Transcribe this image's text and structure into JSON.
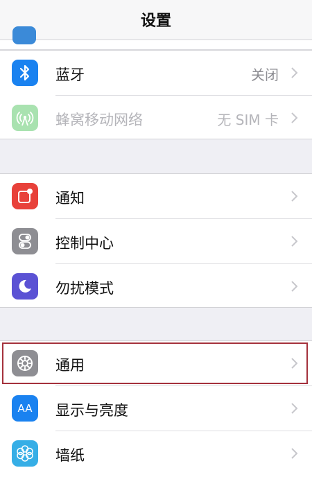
{
  "nav": {
    "title": "设置"
  },
  "groups": {
    "connectivity": {
      "bluetooth": {
        "label": "蓝牙",
        "value": "关闭",
        "icon": "bluetooth-icon",
        "color": "#1a82f0"
      },
      "cellular": {
        "label": "蜂窝移动网络",
        "value": "无 SIM 卡",
        "icon": "antenna-icon",
        "color": "#a9e2b0",
        "disabled": true
      }
    },
    "alerts": {
      "notifications": {
        "label": "通知",
        "icon": "notification-icon",
        "color": "#e8413a"
      },
      "control_center": {
        "label": "控制中心",
        "icon": "toggle-icon",
        "color": "#8e8e93"
      },
      "do_not_disturb": {
        "label": "勿扰模式",
        "icon": "moon-icon",
        "color": "#5b52d4"
      }
    },
    "system": {
      "general": {
        "label": "通用",
        "icon": "gear-icon",
        "color": "#8e8e93",
        "highlighted": true
      },
      "display": {
        "label": "显示与亮度",
        "icon": "text-size-icon",
        "color": "#1a82f0",
        "icon_text": "AA"
      },
      "wallpaper": {
        "label": "墙纸",
        "icon": "flower-icon",
        "color": "#36aee6"
      }
    }
  }
}
